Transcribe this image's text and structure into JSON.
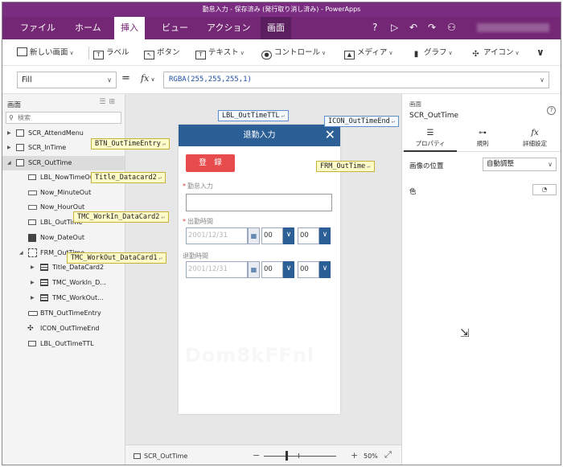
{
  "window": {
    "title": "勤怠入力 - 保存済み (発行取り消し済み) - PowerApps"
  },
  "menu": {
    "items": [
      "ファイル",
      "ホーム",
      "挿入",
      "ビュー",
      "アクション",
      "画面"
    ],
    "icons": [
      "?",
      "▷",
      "↶",
      "↷",
      "⚇"
    ]
  },
  "ribbon": {
    "new_screen": "新しい画面",
    "label": "ラベル",
    "button": "ボタン",
    "text": "テキスト",
    "control": "コントロール",
    "media": "メディア",
    "chart": "グラフ",
    "icon": "アイコン"
  },
  "formula": {
    "property": "Fill",
    "equals": "=",
    "fx": "fx",
    "value": "RGBA(255,255,255,1)"
  },
  "tree": {
    "title": "画面",
    "search_placeholder": "検索",
    "rows": [
      "SCR_AttendMenu",
      "SCR_InTime",
      "SCR_OutTime",
      "LBL_NowTimeOut",
      "Now_MinuteOut",
      "Now_HourOut",
      "LBL_OutTime",
      "Now_DateOut",
      "FRM_OutTime",
      "Title_DataCard2",
      "TMC_WorkIn_D...",
      "TMC_WorkOut...",
      "BTN_OutTimeEntry",
      "ICON_OutTimeEnd",
      "LBL_OutTimeTTL"
    ]
  },
  "app": {
    "header_title": "退勤入力",
    "close_icon": "✕",
    "register_label": "登　録",
    "field1_label": "勤怠入力",
    "field2_label": "出勤時間",
    "field3_label": "退勤時間",
    "required_mark": "*",
    "date_value": "2001/12/31",
    "hour_value": "00",
    "minute_value": "00",
    "ghost_text": "Dom8kFFnl"
  },
  "callouts": {
    "lbl_outtime_ttl": "LBL_OutTimeTTL",
    "icon_outtime_end": "ICON_OutTimeEnd",
    "btn_outtime_entry": "BTN_OutTimeEntry",
    "title_datacard2": "Title_Datacard2",
    "frm_outtime": "FRM_OutTime",
    "tmc_workin_datacard2": "TMC_WorkIn_DataCard2",
    "tmc_workout_datacard1": "TMC_WorkOut_DataCard1",
    "return_mark": "↵"
  },
  "statusbar": {
    "screen_name": "SCR_OutTime",
    "zoom_minus": "−",
    "zoom_plus": "+",
    "zoom_value": "50%"
  },
  "properties": {
    "kind": "画面",
    "name": "SCR_OutTime",
    "tabs": [
      "プロパティ",
      "規則",
      "詳細設定"
    ],
    "image_position_label": "画像の位置",
    "image_position_value": "自動調整",
    "color_label": "色"
  },
  "colors": {
    "brand": "#742774",
    "app_header": "#2d5f97",
    "register_button": "#e84b4b",
    "formula_text": "#1f4fa3"
  }
}
